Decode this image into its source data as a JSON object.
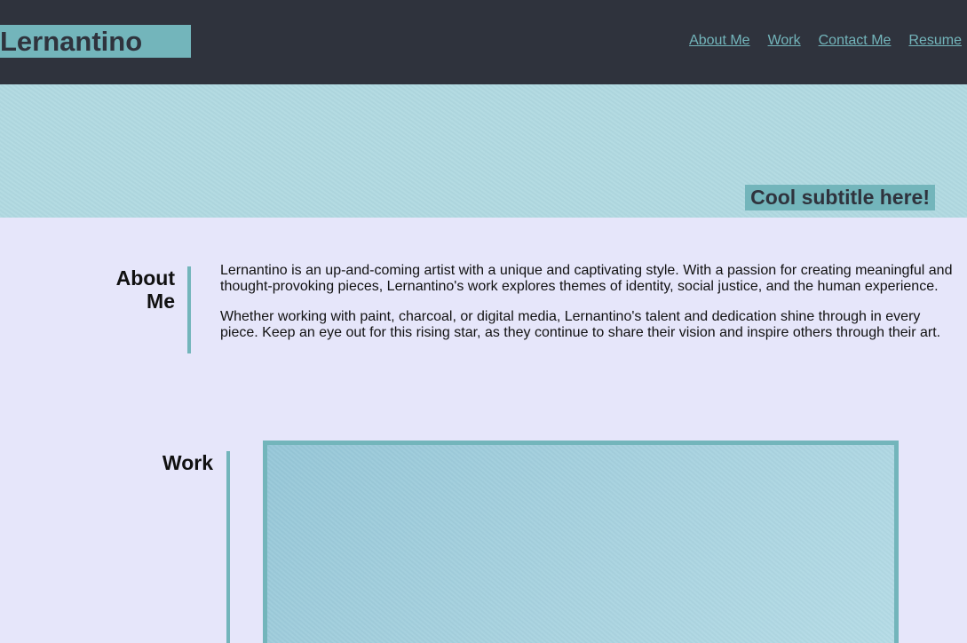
{
  "header": {
    "brand": "Lernantino",
    "nav": [
      {
        "label": "About Me"
      },
      {
        "label": "Work"
      },
      {
        "label": "Contact Me"
      },
      {
        "label": "Resume"
      }
    ]
  },
  "hero": {
    "subtitle": "Cool subtitle here!"
  },
  "about": {
    "heading_line1": "About",
    "heading_line2": "Me",
    "paragraphs": [
      "Lernantino is an up-and-coming artist with a unique and captivating style. With a passion for creating meaningful and thought-provoking pieces, Lernantino's work explores themes of identity, social justice, and the human experience.",
      "Whether working with paint, charcoal, or digital media, Lernantino's talent and dedication shine through in every piece. Keep an eye out for this rising star, as they continue to share their vision and inspire others through their art."
    ]
  },
  "work": {
    "heading": "Work"
  },
  "colors": {
    "header_bg": "#2f333d",
    "accent": "#73b5bb",
    "page_bg": "#e6e6fa",
    "hero_bg": "#b0d9e1"
  }
}
